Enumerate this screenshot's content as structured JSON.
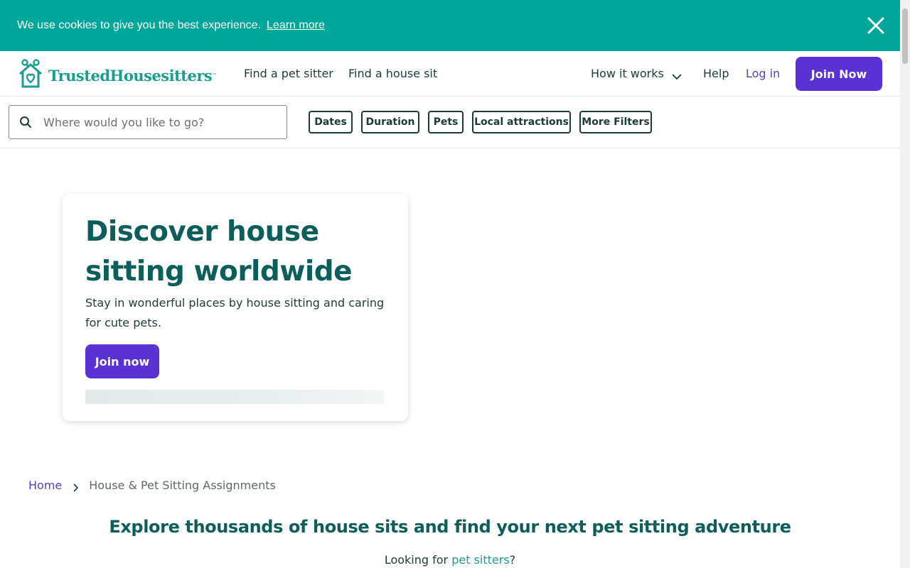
{
  "cookie": {
    "message": "We use cookies to give you the best experience.",
    "learn_more": "Learn more"
  },
  "brand": {
    "name": "TrustedHousesitters",
    "tm": "™",
    "color": "#1a9e8f",
    "accent": "#5a31d3"
  },
  "nav": {
    "find_sitter": "Find a pet sitter",
    "find_house_sit": "Find a house sit",
    "how_it_works": "How it works",
    "help": "Help",
    "login": "Log in",
    "join": "Join Now"
  },
  "search": {
    "placeholder": "Where would you like to go?",
    "value": ""
  },
  "filters": [
    "Dates",
    "Duration",
    "Pets",
    "Local attractions",
    "More Filters"
  ],
  "hero": {
    "title": "Discover house sitting worldwide",
    "subtitle": "Stay in wonderful places by house sitting and caring for cute pets.",
    "cta": "Join now"
  },
  "breadcrumb": {
    "home": "Home",
    "current": "House & Pet Sitting Assignments"
  },
  "explore": {
    "heading": "Explore thousands of house sits and find your next pet sitting adventure",
    "looking_prefix": "Looking for ",
    "looking_link": "pet sitters",
    "looking_suffix": "?"
  }
}
